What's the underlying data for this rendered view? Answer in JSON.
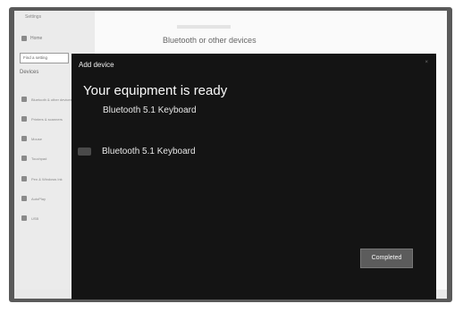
{
  "settings": {
    "app_title": "Settings",
    "home_label": "Home",
    "search_placeholder": "Find a setting",
    "section_label": "Devices",
    "nav_items": [
      {
        "label": "Bluetooth & other devices",
        "icon": "bluetooth-icon"
      },
      {
        "label": "Printers & scanners",
        "icon": "printer-icon"
      },
      {
        "label": "Mouse",
        "icon": "mouse-icon"
      },
      {
        "label": "Touchpad",
        "icon": "touchpad-icon"
      },
      {
        "label": "Pen & Windows Ink",
        "icon": "pen-icon"
      },
      {
        "label": "AutoPlay",
        "icon": "autoplay-icon"
      },
      {
        "label": "USB",
        "icon": "usb-icon"
      }
    ],
    "page_heading": "Bluetooth or other devices"
  },
  "dialog": {
    "title": "Add device",
    "close_glyph": "×",
    "ready_heading": "Your equipment is ready",
    "device_subtitle": "Bluetooth 5.1 Keyboard",
    "device_name": "Bluetooth 5.1 Keyboard",
    "completed_label": "Completed"
  }
}
